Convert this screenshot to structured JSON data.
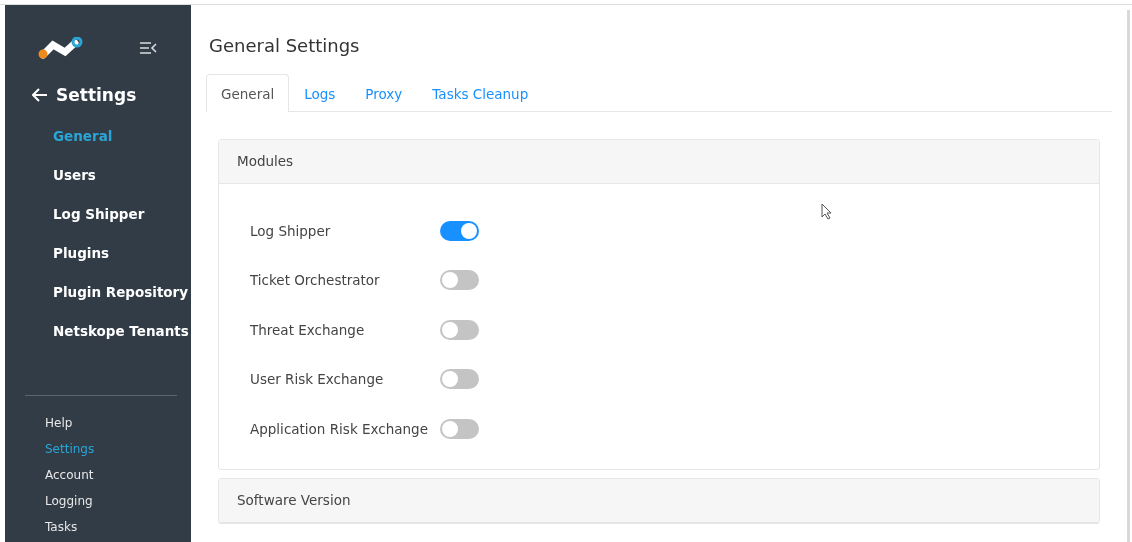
{
  "sidebar": {
    "back_label": "Settings",
    "nav": [
      {
        "label": "General",
        "selected": true
      },
      {
        "label": "Users",
        "selected": false
      },
      {
        "label": "Log Shipper",
        "selected": false
      },
      {
        "label": "Plugins",
        "selected": false
      },
      {
        "label": "Plugin Repository",
        "selected": false
      },
      {
        "label": "Netskope Tenants",
        "selected": false
      }
    ],
    "footer": [
      {
        "label": "Help",
        "selected": false
      },
      {
        "label": "Settings",
        "selected": true
      },
      {
        "label": "Account",
        "selected": false
      },
      {
        "label": "Logging",
        "selected": false
      },
      {
        "label": "Tasks",
        "selected": false
      }
    ]
  },
  "page_title": "General Settings",
  "tabs": [
    {
      "label": "General",
      "selected": true
    },
    {
      "label": "Logs",
      "selected": false
    },
    {
      "label": "Proxy",
      "selected": false
    },
    {
      "label": "Tasks Cleanup",
      "selected": false
    }
  ],
  "sections": [
    {
      "title": "Modules",
      "modules": [
        {
          "label": "Log Shipper",
          "on": true
        },
        {
          "label": "Ticket Orchestrator",
          "on": false
        },
        {
          "label": "Threat Exchange",
          "on": false
        },
        {
          "label": "User Risk Exchange",
          "on": false
        },
        {
          "label": "Application Risk Exchange",
          "on": false
        }
      ]
    },
    {
      "title": "Software Version"
    }
  ]
}
